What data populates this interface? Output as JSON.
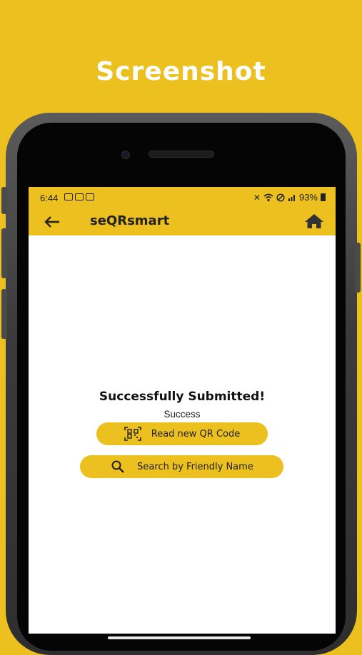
{
  "promo": {
    "title": "Screenshot"
  },
  "status_bar": {
    "time": "6:44",
    "battery": "93%",
    "left_icons": [
      "notification-icon",
      "notification-icon",
      "image-icon"
    ],
    "right_icons": [
      "mute-icon",
      "wifi-icon",
      "dnd-icon",
      "signal-icon",
      "battery-icon"
    ]
  },
  "app_bar": {
    "title": "seQRsmart",
    "back_icon": "arrow-left-icon",
    "home_icon": "home-icon"
  },
  "main": {
    "title": "Successfully Submitted!",
    "subtitle": "Success",
    "buttons": [
      {
        "label": "Read new QR Code",
        "icon": "qr-scan-icon"
      },
      {
        "label": "Search by Friendly Name",
        "icon": "search-icon"
      }
    ]
  },
  "colors": {
    "accent": "#ecc11f",
    "text": "#222222",
    "background": "#ffffff"
  }
}
